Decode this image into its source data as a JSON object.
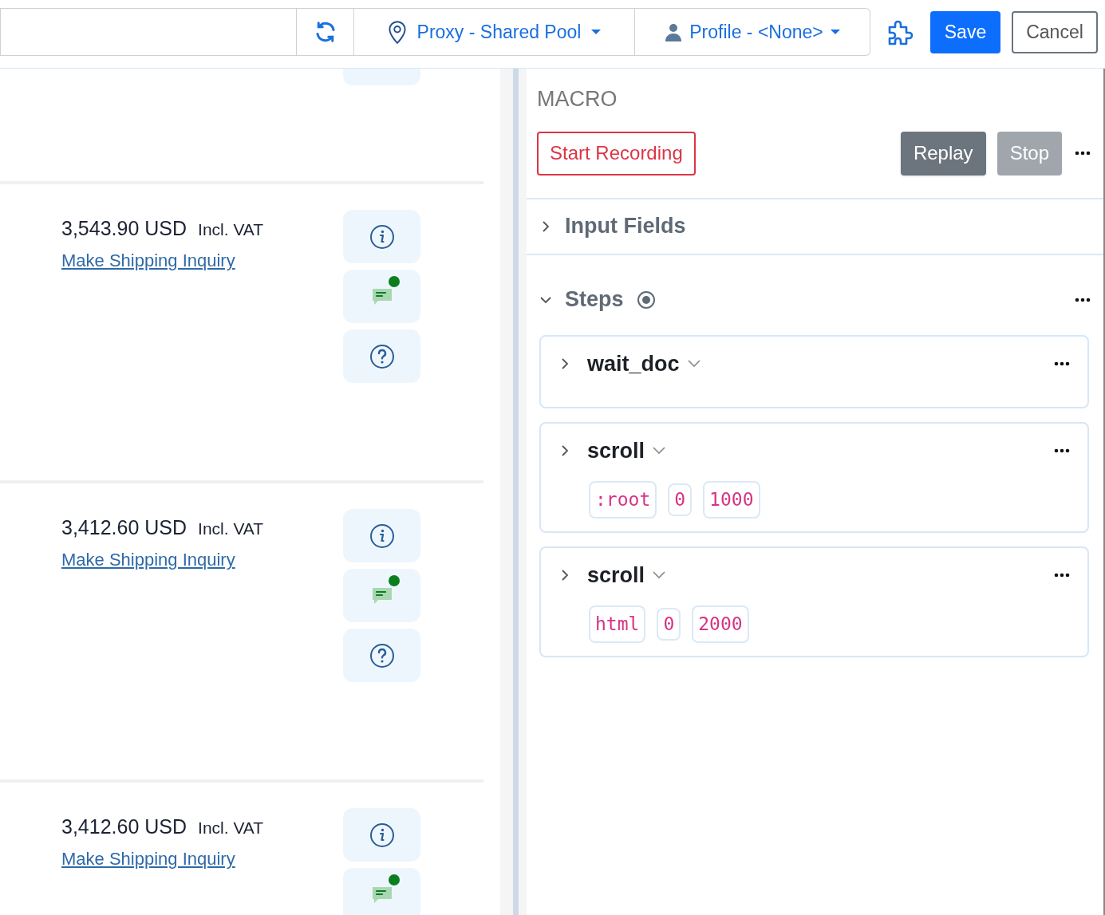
{
  "toolbar": {
    "proxy": "Proxy - Shared Pool",
    "profile": "Profile - <None>",
    "save": "Save",
    "cancel": "Cancel"
  },
  "listings": [
    {
      "price": "3,543.90 USD",
      "vat": "Incl. VAT",
      "link": "Make Shipping Inquiry",
      "buttons": [
        {
          "kind": "info",
          "notification": false
        },
        {
          "kind": "chat",
          "notification": true
        },
        {
          "kind": "help",
          "notification": false
        }
      ]
    },
    {
      "price": "3,412.60 USD",
      "vat": "Incl. VAT",
      "link": "Make Shipping Inquiry",
      "buttons": [
        {
          "kind": "info",
          "notification": false
        },
        {
          "kind": "chat",
          "notification": true
        },
        {
          "kind": "help",
          "notification": false
        }
      ]
    },
    {
      "price": "3,412.60 USD",
      "vat": "Incl. VAT",
      "link": "Make Shipping Inquiry",
      "buttons": [
        {
          "kind": "info",
          "notification": false
        },
        {
          "kind": "chat",
          "notification": true
        }
      ]
    }
  ],
  "macro": {
    "title": "MACRO",
    "record": "Start Recording",
    "replay": "Replay",
    "stop": "Stop",
    "sections": [
      {
        "title": "Input Fields",
        "expanded": false,
        "recording_icon": false
      },
      {
        "title": "Steps",
        "expanded": true,
        "recording_icon": true
      }
    ],
    "steps": [
      {
        "name": "wait_doc"
      },
      {
        "name": "scroll",
        "args": [
          ":root",
          "0",
          "1000"
        ]
      },
      {
        "name": "scroll",
        "args": [
          "html",
          "0",
          "2000"
        ]
      }
    ]
  }
}
